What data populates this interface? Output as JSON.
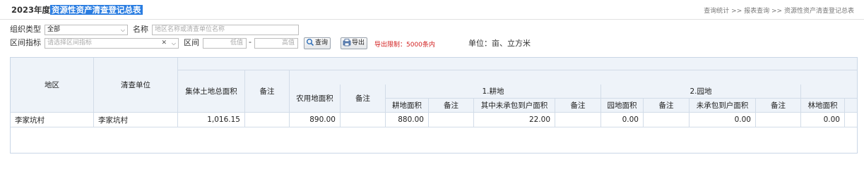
{
  "header": {
    "year_label": "2023年度",
    "title": "资源性资产清查登记总表",
    "breadcrumb": [
      "查询统计",
      ">>",
      "报表查询",
      ">>",
      "资源性资产清查登记总表"
    ]
  },
  "filters": {
    "org_type_label": "组织类型",
    "org_type_value": "全部",
    "name_label": "名称",
    "name_placeholder": "地区名称或清查单位名称",
    "range_indicator_label": "区间指标",
    "range_indicator_placeholder": "请选择区间指标",
    "range_label": "区间",
    "low_placeholder": "低值",
    "dash": "-",
    "high_placeholder": "高值",
    "query_button": "查询",
    "export_button": "导出",
    "export_limit": "导出限制：5000条内",
    "unit_text": "单位：亩、立方米"
  },
  "table": {
    "headers": {
      "region": "地区",
      "unit": "清查单位",
      "collective_total": "集体土地总面积",
      "remark": "备注",
      "farmland_area": "农用地面积",
      "group_farmland": "1.耕地",
      "group_garden": "2.园地",
      "cultivated_area": "耕地面积",
      "uncontracted_area": "其中未承包到户面积",
      "garden_area": "园地面积",
      "garden_uncontracted": "未承包到户面积",
      "forest_area": "林地面积"
    },
    "rows": [
      {
        "region": "李家坑村",
        "unit": "李家坑村",
        "collective_total": "1,016.15",
        "collective_remark": "",
        "farmland_area": "890.00",
        "farmland_remark": "",
        "cultivated_area": "880.00",
        "cultivated_remark": "",
        "uncontracted_area": "22.00",
        "uncontracted_remark": "",
        "garden_area": "0.00",
        "garden_remark": "",
        "garden_uncontracted": "0.00",
        "garden_uncontracted_remark": "",
        "forest_area": "0.00"
      }
    ]
  },
  "colors": {
    "title_highlight": "#2a7de1",
    "header_bg": "#eef3f9",
    "limit_text": "#d21f1f"
  }
}
